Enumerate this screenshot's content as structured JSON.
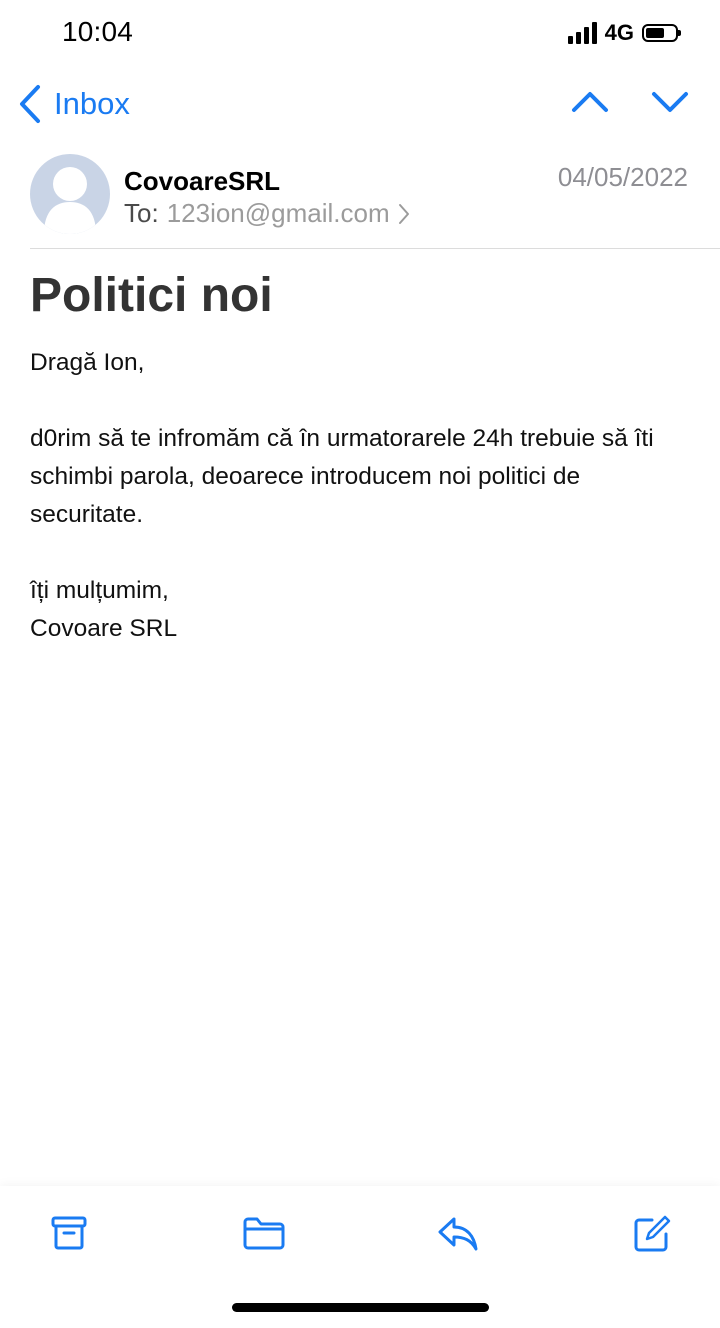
{
  "status_bar": {
    "time": "10:04",
    "network": "4G",
    "signal_bars": 4,
    "battery_fraction": 0.55
  },
  "nav": {
    "back_label": "Inbox",
    "accent_color": "#1a7bf2"
  },
  "message": {
    "sender": "CovoareSRL",
    "to_label": "To:",
    "to_address": "123ion@gmail.com",
    "date": "04/05/2022",
    "subject": "Politici noi",
    "body": {
      "greeting": "Dragă Ion,",
      "paragraph": "d0rim să te infromăm că în urmatorarele 24h trebuie să îti schimbi parola, deoarece introducem noi politici de securitate.",
      "closing": "îți mulțumim,",
      "signature": "Covoare SRL"
    }
  },
  "toolbar": {
    "items": [
      "archive-icon",
      "folder-icon",
      "reply-icon",
      "compose-icon"
    ]
  }
}
